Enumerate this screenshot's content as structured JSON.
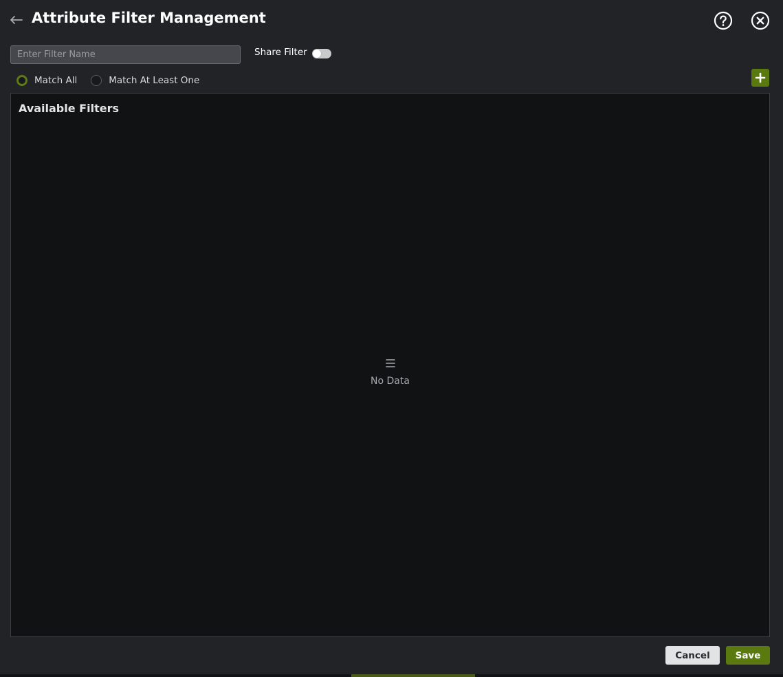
{
  "dialog": {
    "title": "Attribute Filter Management"
  },
  "icons": {
    "back": "arrow-left-icon",
    "help": "question-circle-icon",
    "close": "close-circle-icon",
    "add": "plus-icon",
    "empty": "list-icon"
  },
  "filter_name": {
    "value": "",
    "placeholder": "Enter Filter Name"
  },
  "share": {
    "label": "Share Filter",
    "enabled": false
  },
  "match": {
    "options": [
      {
        "label": "Match All",
        "checked": true
      },
      {
        "label": "Match At Least One",
        "checked": false
      }
    ]
  },
  "available_filters": {
    "title": "Available Filters",
    "empty_text": "No Data"
  },
  "footer": {
    "cancel_label": "Cancel",
    "save_label": "Save"
  },
  "colors": {
    "accent": "#5a7a10",
    "dialog_background": "#222327",
    "panel_background": "#111214"
  }
}
